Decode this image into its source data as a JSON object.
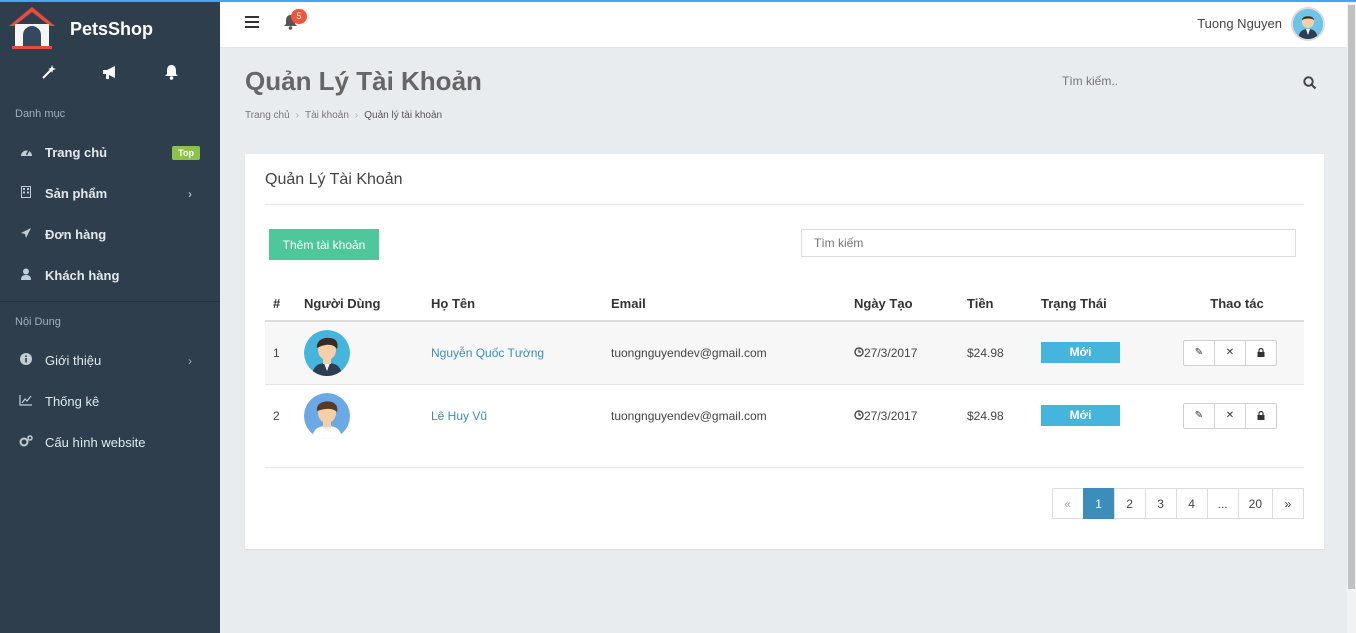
{
  "brand": {
    "name": "PetsShop"
  },
  "sidebar": {
    "sections": [
      {
        "title": "Danh mục"
      },
      {
        "title": "Nội Dung"
      }
    ],
    "items": [
      {
        "label": "Trang chủ",
        "badge": "Top"
      },
      {
        "label": "Sản phẩm"
      },
      {
        "label": "Đơn hàng"
      },
      {
        "label": "Khách hàng"
      },
      {
        "label": "Giới thiệu"
      },
      {
        "label": "Thống kê"
      },
      {
        "label": "Cấu hình website"
      }
    ]
  },
  "header": {
    "notifications": "5",
    "user_name": "Tuong Nguyen"
  },
  "page": {
    "title": "Quản Lý Tài Khoản",
    "breadcrumb": [
      "Trang chủ",
      "Tài khoản",
      "Quản lý tài khoản"
    ],
    "search_placeholder": "Tìm kiếm.."
  },
  "card": {
    "title": "Quản Lý Tài Khoản",
    "add_button": "Thêm tài khoản",
    "search_placeholder": "Tìm kiếm"
  },
  "table": {
    "columns": [
      "#",
      "Người Dùng",
      "Họ Tên",
      "Email",
      "Ngày Tạo",
      "Tiền",
      "Trạng Thái",
      "Thao tác"
    ],
    "rows": [
      {
        "num": "1",
        "name": "Nguyễn Quốc Tường",
        "email": "tuongnguyendev@gmail.com",
        "date": "27/3/2017",
        "money": "$24.98",
        "status": "Mới"
      },
      {
        "num": "2",
        "name": "Lê Huy Vũ",
        "email": "tuongnguyendev@gmail.com",
        "date": "27/3/2017",
        "money": "$24.98",
        "status": "Mới"
      }
    ]
  },
  "pagination": {
    "prev": "«",
    "pages": [
      "1",
      "2",
      "3",
      "4",
      "...",
      "20"
    ],
    "next": "»",
    "current": "1"
  }
}
